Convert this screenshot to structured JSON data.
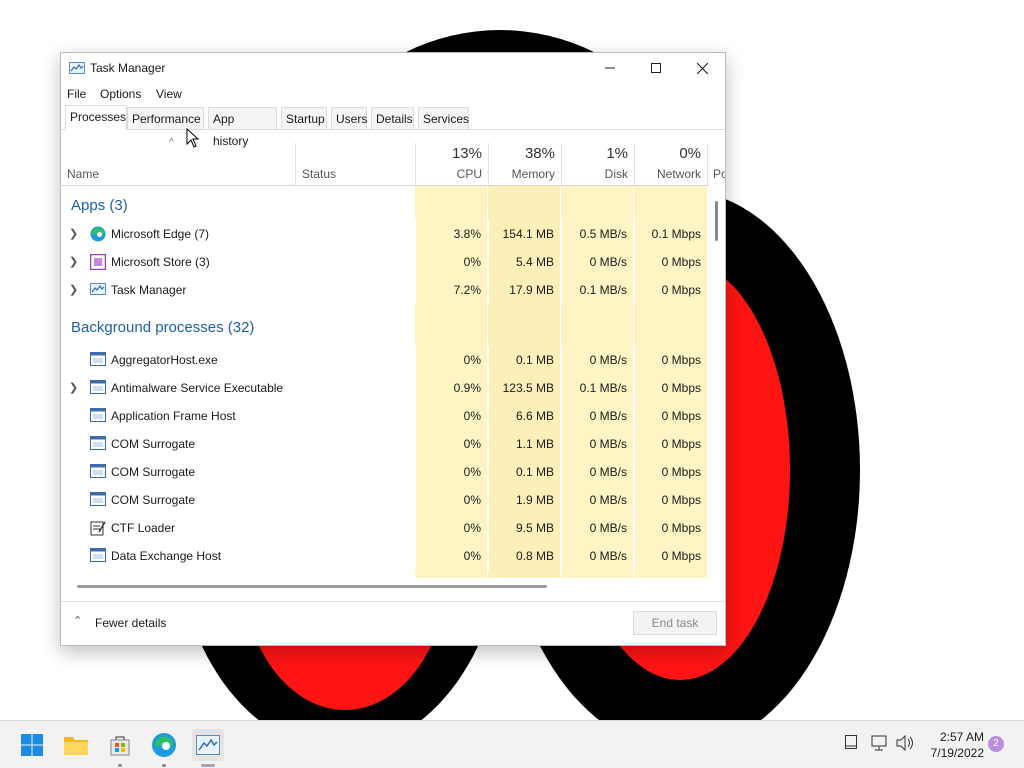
{
  "window": {
    "title": "Task Manager",
    "menu": [
      "File",
      "Options",
      "View"
    ],
    "tabs": [
      "Processes",
      "Performance",
      "App history",
      "Startup",
      "Users",
      "Details",
      "Services"
    ],
    "active_tab": "Processes"
  },
  "columns": {
    "name": "Name",
    "status": "Status",
    "cpu": {
      "pct": "13%",
      "label": "CPU"
    },
    "memory": {
      "pct": "38%",
      "label": "Memory"
    },
    "disk": {
      "pct": "1%",
      "label": "Disk"
    },
    "network": {
      "pct": "0%",
      "label": "Network"
    },
    "power_partial": "Po"
  },
  "groups": {
    "apps": "Apps (3)",
    "background": "Background processes (32)"
  },
  "processes": [
    {
      "name": "Microsoft Edge (7)",
      "icon": "edge-icon",
      "expand": true,
      "cpu": "3.8%",
      "memory": "154.1 MB",
      "disk": "0.5 MB/s",
      "network": "0.1 Mbps"
    },
    {
      "name": "Microsoft Store (3)",
      "icon": "store-icon",
      "expand": true,
      "cpu": "0%",
      "memory": "5.4 MB",
      "disk": "0 MB/s",
      "network": "0 Mbps"
    },
    {
      "name": "Task Manager",
      "icon": "task-manager-icon",
      "expand": true,
      "cpu": "7.2%",
      "memory": "17.9 MB",
      "disk": "0.1 MB/s",
      "network": "0 Mbps"
    },
    {
      "name": "AggregatorHost.exe",
      "icon": "process-icon",
      "expand": false,
      "cpu": "0%",
      "memory": "0.1 MB",
      "disk": "0 MB/s",
      "network": "0 Mbps"
    },
    {
      "name": "Antimalware Service Executable",
      "icon": "process-icon",
      "expand": true,
      "cpu": "0.9%",
      "memory": "123.5 MB",
      "disk": "0.1 MB/s",
      "network": "0 Mbps"
    },
    {
      "name": "Application Frame Host",
      "icon": "process-icon",
      "expand": false,
      "cpu": "0%",
      "memory": "6.6 MB",
      "disk": "0 MB/s",
      "network": "0 Mbps"
    },
    {
      "name": "COM Surrogate",
      "icon": "process-icon",
      "expand": false,
      "cpu": "0%",
      "memory": "1.1 MB",
      "disk": "0 MB/s",
      "network": "0 Mbps"
    },
    {
      "name": "COM Surrogate",
      "icon": "process-icon",
      "expand": false,
      "cpu": "0%",
      "memory": "0.1 MB",
      "disk": "0 MB/s",
      "network": "0 Mbps"
    },
    {
      "name": "COM Surrogate",
      "icon": "process-icon",
      "expand": false,
      "cpu": "0%",
      "memory": "1.9 MB",
      "disk": "0 MB/s",
      "network": "0 Mbps"
    },
    {
      "name": "CTF Loader",
      "icon": "ctf-loader-icon",
      "expand": false,
      "cpu": "0%",
      "memory": "9.5 MB",
      "disk": "0 MB/s",
      "network": "0 Mbps"
    },
    {
      "name": "Data Exchange Host",
      "icon": "process-icon",
      "expand": false,
      "cpu": "0%",
      "memory": "0.8 MB",
      "disk": "0 MB/s",
      "network": "0 Mbps"
    }
  ],
  "footer": {
    "fewer_details": "Fewer details",
    "end_task": "End task"
  },
  "taskbar": {
    "icons": [
      "start-icon",
      "file-explorer-icon",
      "store-icon",
      "edge-icon",
      "task-manager-icon"
    ],
    "time": "2:57 AM",
    "date": "7/19/2022",
    "notification_count": "2"
  },
  "colors": {
    "accent_group_text": "#1e5fae",
    "heat_light": "#fff4c4",
    "heat_medium": "#f9ecb0",
    "wallpaper_red": "#ff1a1a",
    "wallpaper_black": "#000000"
  }
}
